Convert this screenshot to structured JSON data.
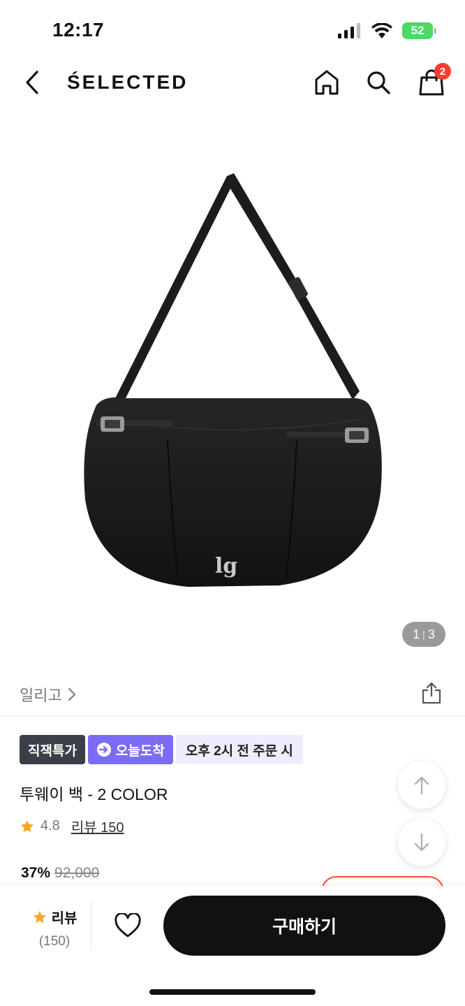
{
  "status": {
    "time": "12:17",
    "battery": "52"
  },
  "header": {
    "brand": "ŚELECTED",
    "cart_count": "2"
  },
  "gallery": {
    "current": "1",
    "total": "3"
  },
  "product": {
    "brand_name": "일리고",
    "badges": {
      "direct": "직잭특가",
      "today": "오늘도착",
      "order_cutoff": "오후 2시 전 주문 시"
    },
    "title": "투웨이 백 - 2 COLOR",
    "rating": "4.8",
    "review_link": "리뷰 150",
    "discount": "37%",
    "original_price": "92,000"
  },
  "bottom_bar": {
    "review_label": "리뷰",
    "review_count": "(150)",
    "buy_label": "구매하기"
  },
  "colors": {
    "accent_purple": "#7b6cf6",
    "badge_dark": "#3c3f47",
    "star": "#f5a623",
    "cart_badge": "#ff3b30",
    "battery": "#4cd964"
  }
}
